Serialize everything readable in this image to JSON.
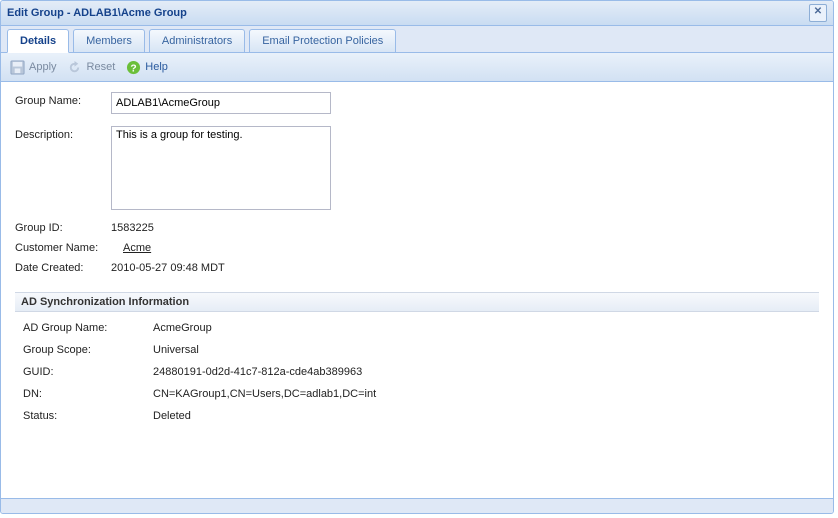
{
  "window": {
    "title": "Edit Group - ADLAB1\\Acme Group"
  },
  "tabs": {
    "details": "Details",
    "members": "Members",
    "administrators": "Administrators",
    "emailPolicies": "Email Protection Policies"
  },
  "toolbar": {
    "apply": "Apply",
    "reset": "Reset",
    "help": "Help"
  },
  "form": {
    "groupNameLabel": "Group Name:",
    "groupNameValue": "ADLAB1\\AcmeGroup",
    "descriptionLabel": "Description:",
    "descriptionValue": "This is a group for testing.",
    "groupIdLabel": "Group ID:",
    "groupIdValue": "1583225",
    "customerNameLabel": "Customer Name:",
    "customerNameValue": "Acme",
    "dateCreatedLabel": "Date Created:",
    "dateCreatedValue": "2010-05-27 09:48 MDT"
  },
  "adSync": {
    "header": "AD Synchronization Information",
    "adGroupNameLabel": "AD Group Name:",
    "adGroupNameValue": "AcmeGroup",
    "groupScopeLabel": "Group Scope:",
    "groupScopeValue": "Universal",
    "guidLabel": "GUID:",
    "guidValue": "24880191-0d2d-41c7-812a-cde4ab389963",
    "dnLabel": "DN:",
    "dnValue": "CN=KAGroup1,CN=Users,DC=adlab1,DC=int",
    "statusLabel": "Status:",
    "statusValue": "Deleted"
  }
}
